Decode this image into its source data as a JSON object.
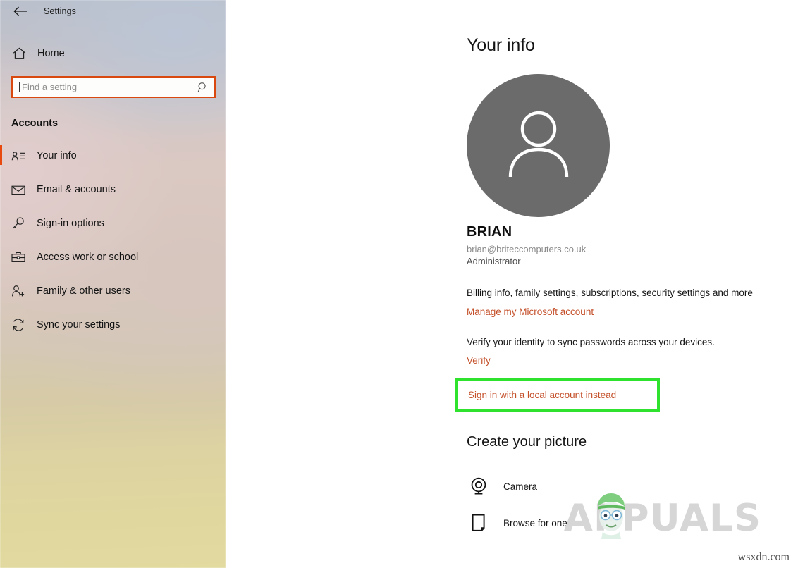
{
  "window": {
    "title": "Settings",
    "back_icon": "back-arrow-icon"
  },
  "sidebar": {
    "home": {
      "label": "Home",
      "icon": "home-icon"
    },
    "search": {
      "placeholder": "Find a setting",
      "value": "",
      "icon": "search-icon"
    },
    "section_label": "Accounts",
    "items": [
      {
        "label": "Your info",
        "icon": "contact-card-icon",
        "active": true
      },
      {
        "label": "Email & accounts",
        "icon": "envelope-icon",
        "active": false
      },
      {
        "label": "Sign-in options",
        "icon": "key-icon",
        "active": false
      },
      {
        "label": "Access work or school",
        "icon": "briefcase-icon",
        "active": false
      },
      {
        "label": "Family & other users",
        "icon": "add-user-icon",
        "active": false
      },
      {
        "label": "Sync your settings",
        "icon": "sync-icon",
        "active": false
      }
    ]
  },
  "main": {
    "page_title": "Your info",
    "avatar_icon": "person-avatar-icon",
    "user_name": "BRIAN",
    "user_email": "brian@briteccomputers.co.uk",
    "user_role": "Administrator",
    "account_block": {
      "description": "Billing info, family settings, subscriptions, security settings and more",
      "link": "Manage my Microsoft account"
    },
    "verify_block": {
      "description": "Verify your identity to sync passwords across your devices.",
      "link": "Verify"
    },
    "local_account_link": "Sign in with a local account instead",
    "create_picture": {
      "title": "Create your picture",
      "options": [
        {
          "label": "Camera",
          "icon": "webcam-icon"
        },
        {
          "label": "Browse for one",
          "icon": "document-page-icon"
        }
      ]
    }
  },
  "watermark": {
    "brand": "APPUALS",
    "site": "wsxdn.com"
  },
  "colors": {
    "accent_orange": "#e8490f",
    "link_orange": "#c4502a",
    "highlight_green": "#2ee22e",
    "avatar_gray": "#6b6b6b"
  }
}
